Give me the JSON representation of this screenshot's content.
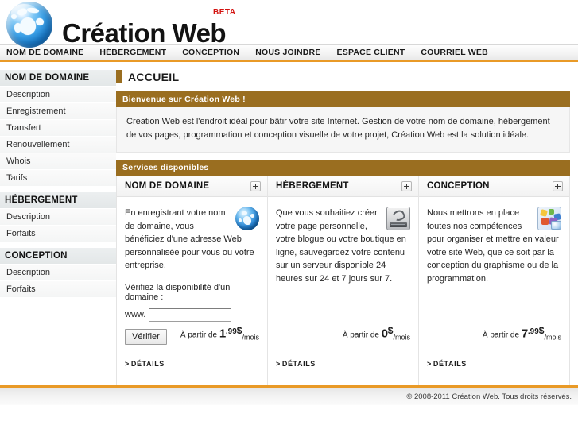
{
  "brand": {
    "name": "Création Web",
    "badge": "BETA",
    "logo_icon": "globe-icon"
  },
  "nav": {
    "items": [
      {
        "label": "NOM DE DOMAINE"
      },
      {
        "label": "HÉBERGEMENT"
      },
      {
        "label": "CONCEPTION"
      },
      {
        "label": "NOUS JOINDRE"
      },
      {
        "label": "ESPACE CLIENT"
      },
      {
        "label": "COURRIEL WEB"
      }
    ]
  },
  "sidebar": {
    "groups": [
      {
        "title": "NOM DE DOMAINE",
        "links": [
          "Description",
          "Enregistrement",
          "Transfert",
          "Renouvellement",
          "Whois",
          "Tarifs"
        ]
      },
      {
        "title": "HÉBERGEMENT",
        "links": [
          "Description",
          "Forfaits"
        ]
      },
      {
        "title": "CONCEPTION",
        "links": [
          "Description",
          "Forfaits"
        ]
      }
    ]
  },
  "main": {
    "page_title": "ACCUEIL",
    "welcome": {
      "bar": "Bienvenue sur Création Web !",
      "text": "Création Web est l'endroit idéal pour bâtir votre site Internet. Gestion de votre nom de domaine, hébergement de vos pages, programmation et conception visuelle de votre projet, Création Web est la solution idéale."
    },
    "services_bar": "Services disponibles",
    "cards": [
      {
        "title": "NOM DE DOMAINE",
        "expand_label": "+",
        "icon": "globe-icon",
        "description": "En enregistrant votre nom de domaine, vous bénéficiez d'une adresse Web personnalisée pour vous ou votre entreprise.",
        "check_label": "Vérifiez la disponibilité d'un domaine :",
        "www_prefix": "www.",
        "input_value": "",
        "input_placeholder": "",
        "submit_label": "Vérifier",
        "price_prefix": "À partir de",
        "price_int": "1",
        "price_dec": ".99",
        "price_currency": "$",
        "price_period": "/mois",
        "details_label": "DÉTAILS"
      },
      {
        "title": "HÉBERGEMENT",
        "expand_label": "+",
        "icon": "disk-drive-icon",
        "description": "Que vous souhaitiez créer votre page personnelle, votre blogue ou votre boutique en ligne, sauvegardez votre contenu sur un serveur disponible 24 heures sur 24 et 7 jours sur 7.",
        "price_prefix": "À partir de",
        "price_int": "0",
        "price_dec": "",
        "price_currency": "$",
        "price_period": "/mois",
        "details_label": "DÉTAILS"
      },
      {
        "title": "CONCEPTION",
        "expand_label": "+",
        "icon": "design-palette-icon",
        "description": "Nous mettrons en place toutes nos compétences pour organiser et mettre en valeur votre site Web, que ce soit par la conception du graphisme ou de la programmation.",
        "price_prefix": "À partir de",
        "price_int": "7",
        "price_dec": ".99",
        "price_currency": "$",
        "price_period": "/mois",
        "details_label": "DÉTAILS"
      }
    ]
  },
  "footer": {
    "copyright": "© 2008-2011 Création Web. Tous droits réservés."
  },
  "colors": {
    "accent_orange": "#e99a27",
    "bar_brown": "#9a6e20",
    "beta_red": "#d3120f"
  }
}
